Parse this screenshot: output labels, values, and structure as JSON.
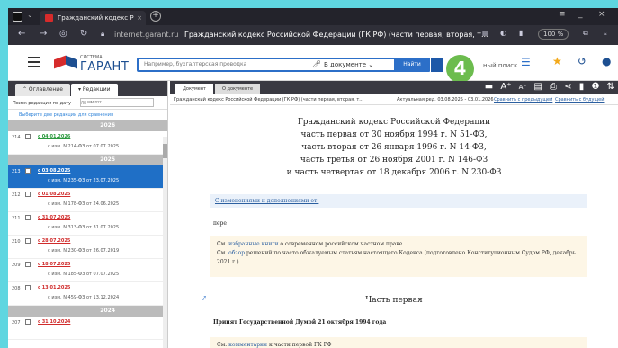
{
  "browser": {
    "tab_title": "Гражданский кодекс Р",
    "tab_close": "×",
    "url_host": "internet.garant.ru",
    "url_title": "Гражданский кодекс Российской Федерации (ГК РФ) (части первая, вторая, т...",
    "zoom": "100 %",
    "window_minimize": "_",
    "window_close": "×",
    "window_menu": "≡"
  },
  "header": {
    "logo_system": "СИСТЕМА",
    "logo_name": "ГАРАНТ",
    "search_placeholder": "Например, бухгалтерская проводка",
    "search_scope": "В документе  ⌄",
    "find_button": "Найти",
    "smart_search": "ный поиск",
    "badge_3": "3",
    "badge_4": "4"
  },
  "left": {
    "tab_contents": "⌃ Оглавление",
    "tab_editions": "▾ Редакции",
    "date_label": "Поиск редакции по дату",
    "date_placeholder": "дд.мм.гггг",
    "hint": "Выберите две редакции для сравнения",
    "year_2026": "2026",
    "year_2025": "2025",
    "year_2024": "2024",
    "editions": [
      {
        "n": "214",
        "date": "с 04.01.2026",
        "src": "с изм. N 214-ФЗ от 07.07.2025"
      },
      {
        "n": "213",
        "date": "с 03.08.2025",
        "src": "с изм. N 235-ФЗ от 23.07.2025"
      },
      {
        "n": "212",
        "date": "с 01.08.2025",
        "src": "с изм. N 178-ФЗ от 24.06.2025"
      },
      {
        "n": "211",
        "date": "с 31.07.2025",
        "src": "с изм. N 313-ФЗ от 31.07.2025"
      },
      {
        "n": "210",
        "date": "с 28.07.2025",
        "src": "с изм. N 230-ФЗ от 26.07.2019"
      },
      {
        "n": "209",
        "date": "с 18.07.2025",
        "src": "с изм. N 185-ФЗ от 07.07.2025"
      },
      {
        "n": "208",
        "date": "с 13.01.2025",
        "src": "с изм. N 459-ФЗ от 13.12.2024"
      },
      {
        "n": "207",
        "date": "с 31.10.2024",
        "src": ""
      }
    ]
  },
  "doc": {
    "tab_document": "Документ",
    "tab_about": "О документе",
    "info_title": "Гражданский кодекс Российской Федерации (ГК РФ) (части первая, вторая, т...",
    "info_actual": "Актуальная ред. 03.08.2025 - 03.01.2026",
    "info_compare_prev": "Сравнить с предыдущей",
    "info_compare_next": "Сравнить с будущей",
    "title_lines": [
      "Гражданский кодекс Российской Федерации",
      "часть первая от 30 ноября 1994 г. N 51-ФЗ,",
      "часть вторая от 26 января 1996 г. N 14-ФЗ,",
      "часть третья от 26 ноября 2001 г. N 146-ФЗ",
      "и часть четвертая от 18 декабря 2006 г. N 230-ФЗ"
    ],
    "changes": "С изменениями и дополнениями от:",
    "pere": "пере",
    "note1_a": "См. ",
    "note1_link": "избранные книги",
    "note1_b": " о современном российском частном праве",
    "note2_a": "См. ",
    "note2_link": "обзор",
    "note2_b": " решений по часто обжалуемым статьям настоящего Кодекса (подготовлено Конституционным Судом РФ, декабрь 2021 г.)",
    "part_one": "Часть первая",
    "accepted": "Принят Государственной Думой 21 октября 1994 года",
    "note3_a": "См. ",
    "note3_link": "комментарии",
    "note3_b": " к части первой ГК РФ"
  }
}
